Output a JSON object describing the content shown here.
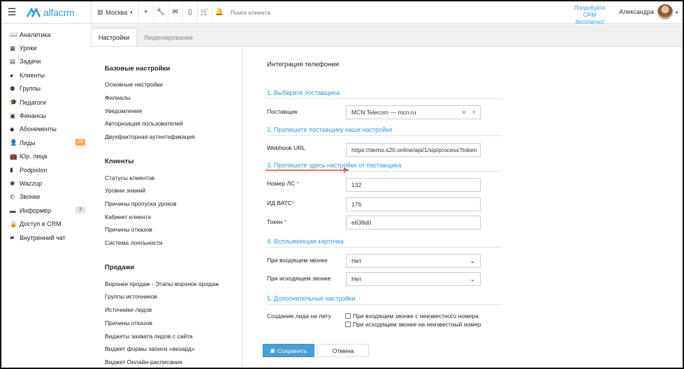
{
  "header": {
    "logo_text": "alfacrm",
    "branch": "Москва",
    "search_placeholder": "Поиск клиента",
    "promo_line1": "Попробуйте",
    "promo_line2": "CRM бесплатно!",
    "user_name": "Александра",
    "brand_color": "#2a9fd8"
  },
  "nav": {
    "items": [
      {
        "label": "Аналитика",
        "icon": "book-icon"
      },
      {
        "label": "Уроки",
        "icon": "calendar-icon"
      },
      {
        "label": "Задачи",
        "icon": "clipboard-icon"
      },
      {
        "label": "Клиенты",
        "icon": "user-icon"
      },
      {
        "label": "Группы",
        "icon": "users-icon"
      },
      {
        "label": "Педагоги",
        "icon": "graduation-icon"
      },
      {
        "label": "Финансы",
        "icon": "money-icon"
      },
      {
        "label": "Абонементы",
        "icon": "tag-icon"
      },
      {
        "label": "Лиды",
        "icon": "user-plus-icon",
        "badge": "29"
      },
      {
        "label": "Юр. лица",
        "icon": "briefcase-icon"
      },
      {
        "label": "Podpislon",
        "icon": "file-icon"
      },
      {
        "label": "Wazzup",
        "icon": "whatsapp-icon"
      },
      {
        "label": "Звонки",
        "icon": "phone-icon"
      },
      {
        "label": "Информер",
        "icon": "inbox-icon",
        "badge": "3"
      },
      {
        "label": "Доступ в CRM",
        "icon": "lock-icon"
      },
      {
        "label": "Внутренний чат",
        "icon": "chat-icon"
      }
    ]
  },
  "tabs": {
    "settings": "Настройки",
    "licensing": "Лицензирование"
  },
  "settings": {
    "basic_title": "Базовые настройки",
    "basic": [
      "Основные настройки",
      "Филиалы",
      "Уведомления",
      "Авторизация пользователей",
      "Двухфакторная аутентификация"
    ],
    "clients_title": "Клиенты",
    "clients": [
      "Статусы клиентов",
      "Уровни знаний",
      "Причины пропуска уроков",
      "Кабинет клиента",
      "Причины отказов",
      "Система лояльности"
    ],
    "sales_title": "Продажи",
    "sales": [
      "Воронки продаж - Этапы воронок продаж",
      "Группы источников",
      "Источники лидов",
      "Причины отказов",
      "Виджеты захвата лидов с сайта",
      "Виджет формы записи «визард»",
      "Виджет Онлайн-расписание"
    ]
  },
  "form": {
    "title": "Интеграция телефонии",
    "step1": "1. Выберите поставщика",
    "provider_label": "Поставщик",
    "provider_value": "MCN Telecom — mcn.ru",
    "step2": "2. Пропишите поставщику наши настройки",
    "webhook_label": "Webhook URL",
    "webhook_value": "https://demo.s20.online/api/1/sip/process?token",
    "step3": "3. Пропишите здесь настройки от поставщика",
    "account_label": "Номер ЛС",
    "account_value": "132",
    "pbx_label": "ИД ВАТС",
    "pbx_value": "176",
    "token_label": "Токен",
    "token_value": "e638d0",
    "step4": "4. Всплывающая карточка",
    "incoming_label": "При входящем звонке",
    "incoming_value": "Нет",
    "outgoing_label": "При исходящем звонке",
    "outgoing_value": "Нет",
    "step5": "5. Дополнительные настройки",
    "lead_label": "Создание лида на лету",
    "chk_incoming": "При входящем звонке с неизвестного номера",
    "chk_outgoing": "При исходящем звонке на неизвестный номер",
    "required_mark": "*",
    "save": "Сохранить",
    "cancel": "Отмена",
    "accent_color": "#e74c3c"
  }
}
